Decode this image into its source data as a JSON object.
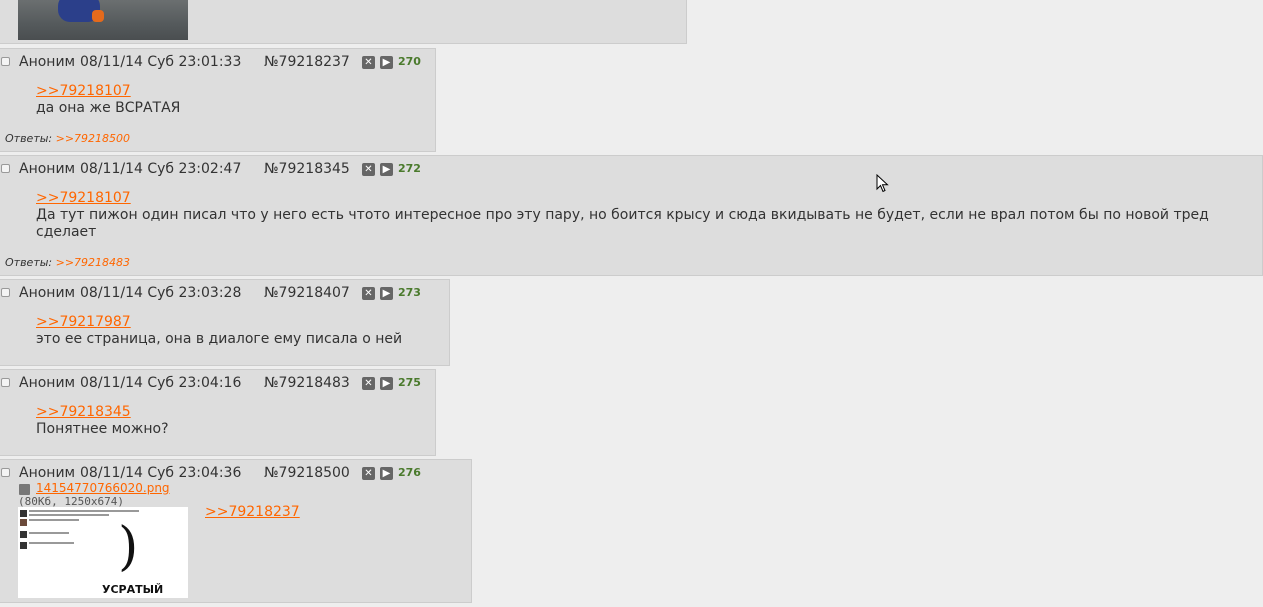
{
  "icons": {
    "hide": "close-icon",
    "expand": "play-icon",
    "file": "image-file-icon"
  },
  "posts": [
    {
      "name": "Аноним",
      "date": "08/11/14 Суб 23:01:33",
      "num": "№79218237",
      "count": "270",
      "ref": ">>79218107",
      "text": "да она же ВСРАТАЯ",
      "replies_label": "Ответы:",
      "replies": ">>79218500"
    },
    {
      "name": "Аноним",
      "date": "08/11/14 Суб 23:02:47",
      "num": "№79218345",
      "count": "272",
      "ref": ">>79218107",
      "text": "Да тут пижон один писал что у него есть чтото интересное про эту пару, но боится крысу и сюда вкидывать не будет, если не врал потом бы по новой тред сделает",
      "replies_label": "Ответы:",
      "replies": ">>79218483"
    },
    {
      "name": "Аноним",
      "date": "08/11/14 Суб 23:03:28",
      "num": "№79218407",
      "count": "273",
      "ref": ">>79217987",
      "text": "это ее страница, она в диалоге ему писала о ней"
    },
    {
      "name": "Аноним",
      "date": "08/11/14 Суб 23:04:16",
      "num": "№79218483",
      "count": "275",
      "ref": ">>79218345",
      "text": "Понятнее можно?"
    },
    {
      "name": "Аноним",
      "date": "08/11/14 Суб 23:04:36",
      "num": "№79218500",
      "count": "276",
      "file_name": "14154770766020.png",
      "file_info": "(80Кб, 1250x674)",
      "thumb_caption": "УСРАТЫЙ",
      "thumb_symbol": ")",
      "ref": ">>79218237"
    }
  ]
}
